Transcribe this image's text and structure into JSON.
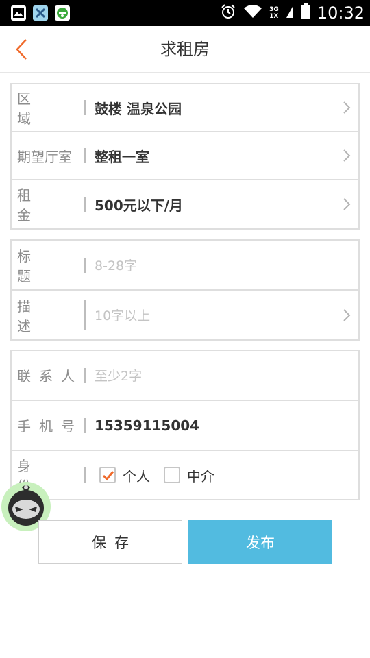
{
  "status_bar": {
    "time": "10:32",
    "network_top": "3G",
    "network_bottom": "1X",
    "icons": [
      "gallery-icon",
      "cancel-notify-icon",
      "green-app-icon",
      "alarm-icon",
      "wifi-icon",
      "signal-icon",
      "battery-icon"
    ]
  },
  "header": {
    "title": "求租房",
    "back_icon": "chevron-left-icon"
  },
  "sections": {
    "location": {
      "region_label": "区域",
      "region_value": "鼓楼 温泉公园",
      "rooms_label": "期望厅室",
      "rooms_value": "整租一室",
      "rent_label": "租金",
      "rent_value": "500元以下/月"
    },
    "details": {
      "title_label": "标题",
      "title_placeholder": "8-28字",
      "desc_label": "描述",
      "desc_placeholder": "10字以上"
    },
    "contact": {
      "contact_label": "联系人",
      "contact_placeholder": "至少2字",
      "phone_label": "手机号",
      "phone_value": "15359115004",
      "identity_label": "身份",
      "identity_options": [
        {
          "label": "个人",
          "checked": true
        },
        {
          "label": "中介",
          "checked": false
        }
      ]
    }
  },
  "actions": {
    "save_label": "保存",
    "publish_label": "发布"
  },
  "colors": {
    "accent_orange": "#f06a2b",
    "publish_blue": "#52bbe0",
    "border": "#dedede",
    "placeholder": "#c4c4c4"
  }
}
